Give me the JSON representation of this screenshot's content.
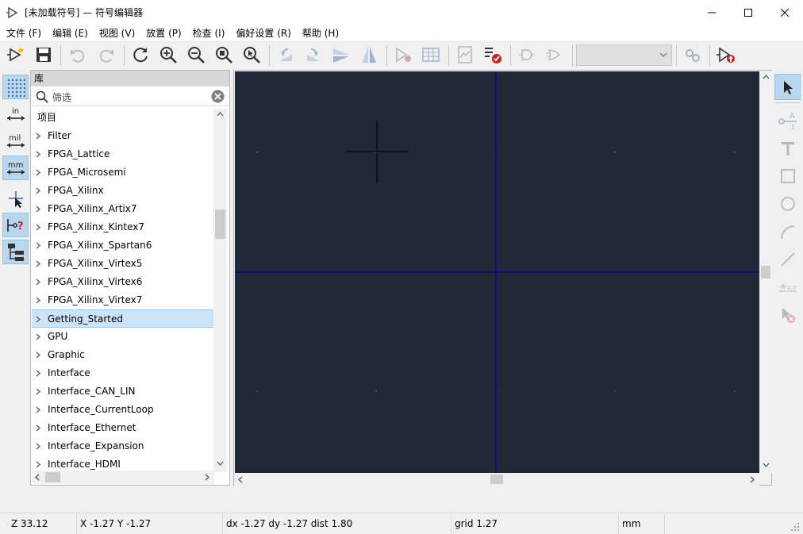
{
  "window": {
    "title": "[未加载符号] — 符号编辑器",
    "minimize_glyph": "—",
    "maximize_glyph": "☐",
    "close_glyph": "✕"
  },
  "menu": [
    "文件 (F)",
    "编辑 (E)",
    "视图 (V)",
    "放置 (P)",
    "检查 (I)",
    "偏好设置 (R)",
    "帮助 (H)"
  ],
  "toolbar": {
    "icons": [
      "new-symbol-icon",
      "save-icon",
      "undo-icon",
      "redo-icon",
      "refresh-icon",
      "zoom-in-icon",
      "zoom-out-icon",
      "zoom-fit-icon",
      "zoom-selection-icon",
      "rotate-ccw-icon",
      "rotate-cw-icon",
      "mirror-h-icon",
      "mirror-v-icon",
      "symbol-properties-icon",
      "pin-table-icon",
      "datasheet-icon",
      "erc-check-icon",
      "unit-a-icon",
      "unit-b-icon",
      "sync-pins-icon",
      "export-symbol-icon"
    ],
    "unit_select_value": ""
  },
  "left_tools": [
    "grid-icon",
    "inch-units-icon",
    "mil-units-icon",
    "mm-units-icon",
    "cursor-crosshair-icon",
    "pin-type-icon",
    "hierarchy-tree-icon"
  ],
  "library": {
    "header": "库",
    "search_placeholder": "筛选",
    "column_header": "项目",
    "items": [
      "Filter",
      "FPGA_Lattice",
      "FPGA_Microsemi",
      "FPGA_Xilinx",
      "FPGA_Xilinx_Artix7",
      "FPGA_Xilinx_Kintex7",
      "FPGA_Xilinx_Spartan6",
      "FPGA_Xilinx_Virtex5",
      "FPGA_Xilinx_Virtex6",
      "FPGA_Xilinx_Virtex7",
      "Getting_Started",
      "GPU",
      "Graphic",
      "Interface",
      "Interface_CAN_LIN",
      "Interface_CurrentLoop",
      "Interface_Ethernet",
      "Interface_Expansion",
      "Interface_HDMI"
    ],
    "selected_item": "Getting_Started"
  },
  "right_tools": [
    "select-arrow-icon",
    "pin-icon",
    "text-icon",
    "rectangle-icon",
    "circle-icon",
    "arc-icon",
    "line-icon",
    "anchor-icon",
    "delete-icon"
  ],
  "status": {
    "zoom": "Z 33.12",
    "coords": "X -1.27  Y -1.27",
    "delta": "dx -1.27  dy -1.27  dist 1.80",
    "grid": "grid 1.27",
    "units": "mm"
  },
  "colors": {
    "canvas_bg": "#222835",
    "axis": "#0000aa",
    "cursor": "#000000",
    "selection": "#cce4f7",
    "active_tool": "#b9d6ef"
  }
}
